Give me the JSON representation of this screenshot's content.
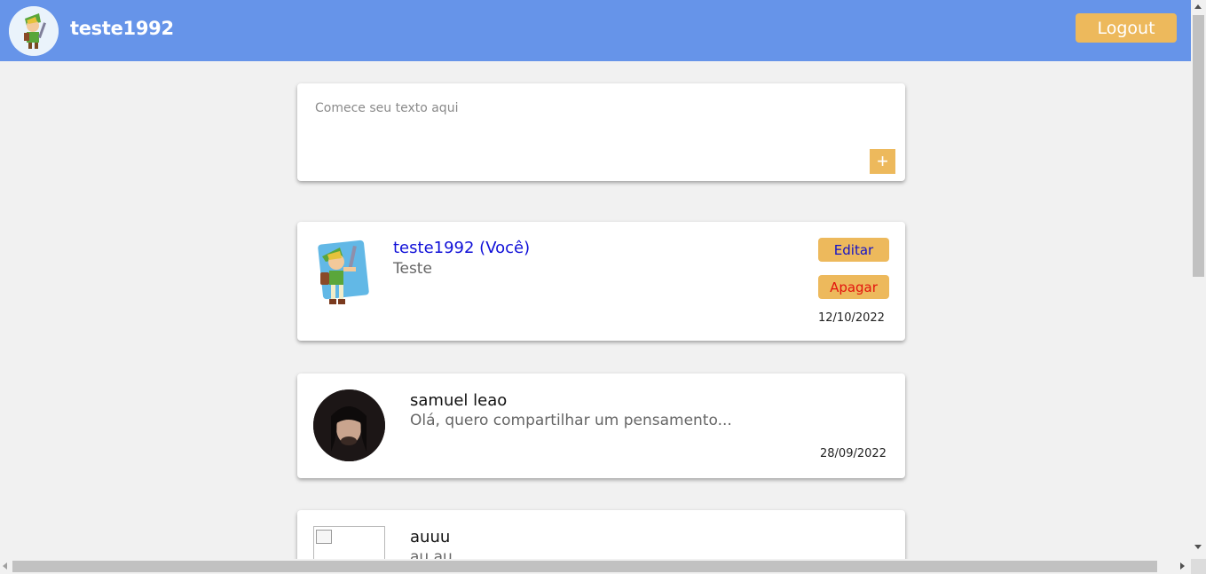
{
  "header": {
    "username": "teste1992",
    "logout_label": "Logout",
    "background": "#6694e9",
    "accent": "#edb95c"
  },
  "composer": {
    "placeholder": "Comece seu texto aqui",
    "add_label": "+"
  },
  "posts": [
    {
      "author": "teste1992 (Você)",
      "text": "Teste",
      "date": "12/10/2022",
      "edit_label": "Editar",
      "delete_label": "Apagar",
      "avatar": "link-character-avatar"
    },
    {
      "author": "samuel leao",
      "text": "Olá, quero compartilhar um pensamento...",
      "date": "28/09/2022",
      "avatar": "photo-avatar"
    },
    {
      "author": "auuu",
      "text": "au au",
      "avatar": "broken-image"
    }
  ]
}
